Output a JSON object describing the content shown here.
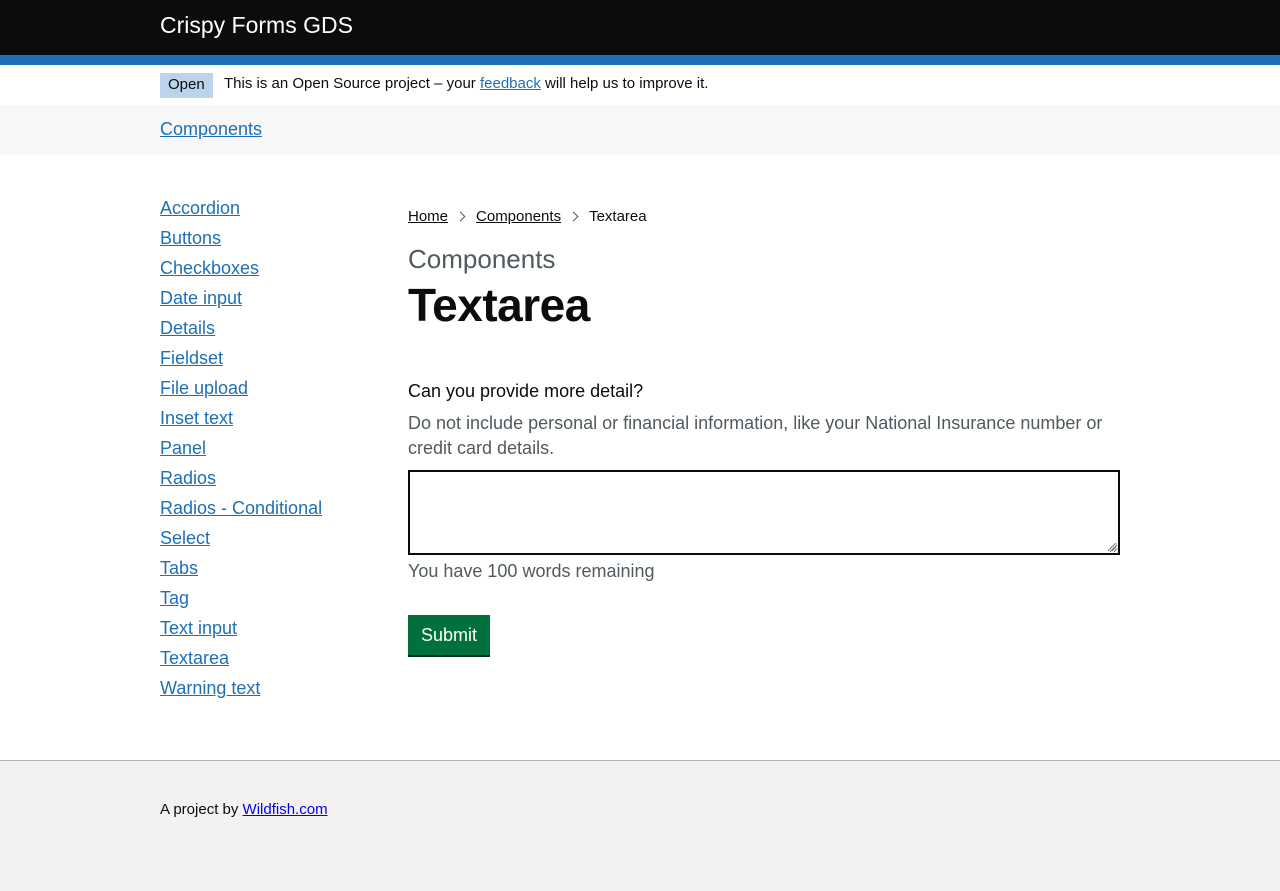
{
  "header": {
    "title": "Crispy Forms GDS"
  },
  "phase_banner": {
    "tag": "Open",
    "text_before": "This is an Open Source project – your ",
    "link": "feedback",
    "text_after": " will help us to improve it."
  },
  "subnav": {
    "link": "Components"
  },
  "sidebar": {
    "items": [
      {
        "label": "Accordion"
      },
      {
        "label": "Buttons"
      },
      {
        "label": "Checkboxes"
      },
      {
        "label": "Date input"
      },
      {
        "label": "Details"
      },
      {
        "label": "Fieldset"
      },
      {
        "label": "File upload"
      },
      {
        "label": "Inset text"
      },
      {
        "label": "Panel"
      },
      {
        "label": "Radios"
      },
      {
        "label": "Radios - Conditional"
      },
      {
        "label": "Select"
      },
      {
        "label": "Tabs"
      },
      {
        "label": "Tag"
      },
      {
        "label": "Text input"
      },
      {
        "label": "Textarea"
      },
      {
        "label": "Warning text"
      }
    ]
  },
  "breadcrumbs": {
    "home": "Home",
    "components": "Components",
    "current": "Textarea"
  },
  "main": {
    "caption": "Components",
    "title": "Textarea",
    "form": {
      "label": "Can you provide more detail?",
      "hint": "Do not include personal or financial information, like your National Insurance number or credit card details.",
      "textarea_value": "",
      "counter": "You have 100 words remaining",
      "submit_label": "Submit"
    }
  },
  "footer": {
    "text": "A project by ",
    "link": "Wildfish.com"
  },
  "colors": {
    "header_bg": "#0b0c0c",
    "brand_blue": "#1d70b8",
    "tag_bg": "#bbd4ea",
    "button_green": "#00703c",
    "footer_bg": "#f3f2f1"
  }
}
